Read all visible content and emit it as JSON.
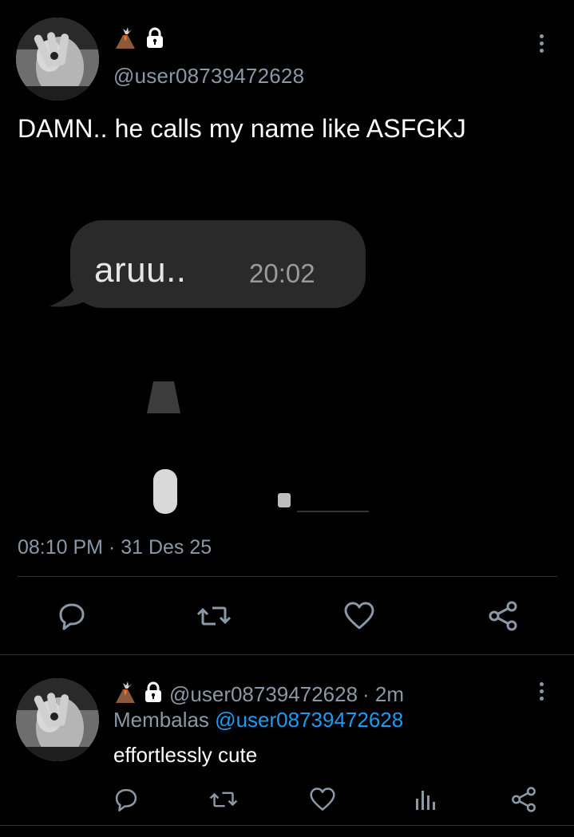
{
  "tweet": {
    "handle": "@user08739472628",
    "text": "DAMN.. he calls my name like ASFGKJ",
    "timestamp": "08:10 PM · 31 Des 25",
    "media": {
      "bubble_text": "aruu..",
      "bubble_time": "20:02"
    }
  },
  "actions": [
    "reply-icon",
    "retweet-icon",
    "like-icon",
    "share-icon"
  ],
  "reply": {
    "handle": "@user08739472628",
    "time": "· 2m",
    "replying_prefix": "Membalas",
    "replying_to": "@user08739472628",
    "text": "effortlessly cute",
    "actions": [
      "reply-icon",
      "retweet-icon",
      "like-icon",
      "views-icon",
      "share-icon"
    ]
  },
  "colors": {
    "background": "#000000",
    "secondary_text": "#8b98a5",
    "link": "#1d9bf0",
    "divider": "#2f3336"
  }
}
